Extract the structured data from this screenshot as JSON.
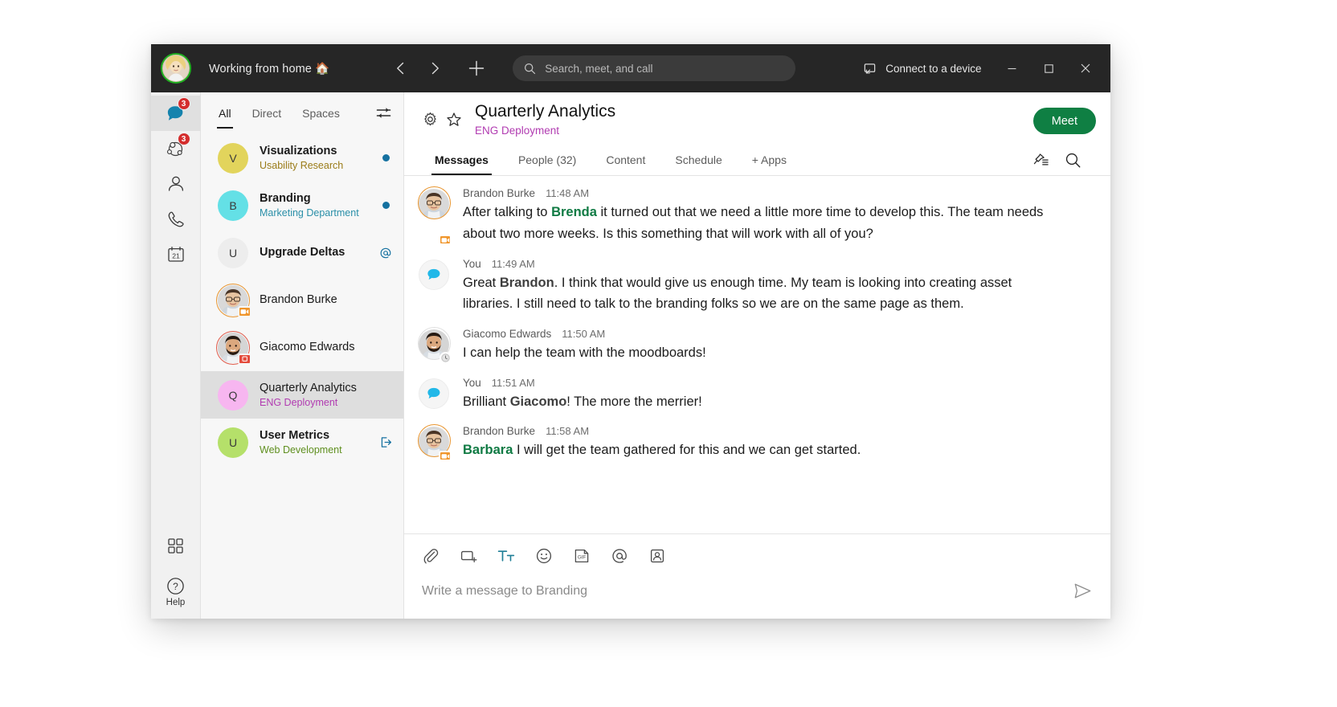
{
  "titlebar": {
    "status_text": "Working from home 🏠",
    "back_icon": "chevron-left-icon",
    "forward_icon": "chevron-right-icon",
    "add_icon": "plus-icon",
    "search_placeholder": "Search, meet, and call",
    "connect_label": "Connect to a device",
    "minimize_label": "–",
    "maximize_label": "□",
    "close_label": "✕"
  },
  "rail": {
    "items": [
      {
        "name": "messaging",
        "icon": "chat-bubble-icon",
        "badge": "3",
        "active": true
      },
      {
        "name": "teams",
        "icon": "teams-network-icon",
        "badge": "3",
        "active": false
      },
      {
        "name": "contacts",
        "icon": "person-icon",
        "badge": "",
        "active": false
      },
      {
        "name": "calling",
        "icon": "phone-icon",
        "badge": "",
        "active": false
      },
      {
        "name": "meetings",
        "icon": "calendar-21-icon",
        "badge": "",
        "active": false
      }
    ],
    "apps_icon": "apps-grid-icon",
    "help_icon": "question-circle-icon",
    "help_label": "Help"
  },
  "conversation_list": {
    "tabs": [
      {
        "label": "All",
        "active": true
      },
      {
        "label": "Direct",
        "active": false
      },
      {
        "label": "Spaces",
        "active": false
      }
    ],
    "filter_icon": "filter-sliders-icon",
    "items": [
      {
        "avatar_letter": "V",
        "avatar_color": "#e2d45c",
        "title": "Visualizations",
        "subtitle": "Usability Research",
        "subtitle_color": "#9a7b17",
        "bold": true,
        "indicator": "unread-dot",
        "selected": false,
        "avatar_type": "letter"
      },
      {
        "avatar_letter": "B",
        "avatar_color": "#64e0e6",
        "title": "Branding",
        "subtitle": "Marketing Department",
        "subtitle_color": "#2a8fa8",
        "bold": true,
        "indicator": "unread-dot",
        "selected": false,
        "avatar_type": "letter"
      },
      {
        "avatar_letter": "U",
        "avatar_color": "#ededed",
        "title": "Upgrade Deltas",
        "subtitle": "",
        "subtitle_color": "",
        "bold": true,
        "indicator": "mention-at",
        "selected": false,
        "avatar_type": "letter"
      },
      {
        "avatar_letter": "",
        "avatar_color": "#d5d5d5",
        "title": "Brandon Burke",
        "subtitle": "",
        "subtitle_color": "",
        "bold": false,
        "indicator": "",
        "selected": false,
        "avatar_type": "photo-man-glasses",
        "presence": "video"
      },
      {
        "avatar_letter": "",
        "avatar_color": "#d5d5d5",
        "title": "Giacomo Edwards",
        "subtitle": "",
        "subtitle_color": "",
        "bold": false,
        "indicator": "",
        "selected": false,
        "avatar_type": "photo-man-beard",
        "presence": "dnd"
      },
      {
        "avatar_letter": "Q",
        "avatar_color": "#f7b6f0",
        "title": "Quarterly Analytics",
        "subtitle": "ENG Deployment",
        "subtitle_color": "#b13bb1",
        "bold": false,
        "indicator": "",
        "selected": true,
        "avatar_type": "letter"
      },
      {
        "avatar_letter": "U",
        "avatar_color": "#b5e06a",
        "title": "User Metrics",
        "subtitle": "Web Development",
        "subtitle_color": "#5f8f1f",
        "bold": true,
        "indicator": "leave-space",
        "selected": false,
        "avatar_type": "letter"
      }
    ]
  },
  "space_header": {
    "settings_icon": "gear-icon",
    "favorite_icon": "star-icon",
    "title": "Quarterly Analytics",
    "subtitle": "ENG Deployment",
    "meet_button_label": "Meet",
    "meet_button_color": "#0f7f43",
    "tabs": [
      {
        "label": "Messages",
        "active": true
      },
      {
        "label": "People (32)",
        "active": false
      },
      {
        "label": "Content",
        "active": false
      },
      {
        "label": "Schedule",
        "active": false
      },
      {
        "label": "+ Apps",
        "active": false
      }
    ],
    "pin_icon": "pinned-list-icon",
    "search_icon": "search-icon"
  },
  "messages": [
    {
      "author": "Brandon Burke",
      "time": "11:48 AM",
      "avatar_type": "photo-man-glasses",
      "presence": "video",
      "segments": [
        {
          "t": "After talking to ",
          "style": "plain"
        },
        {
          "t": "Brenda",
          "style": "mention-green"
        },
        {
          "t": " it turned out that we need a little more time to develop this. The team needs about two more weeks. Is this something that will work with all of you?",
          "style": "plain"
        }
      ]
    },
    {
      "author": "You",
      "time": "11:49 AM",
      "avatar_type": "you-bubble",
      "presence": "",
      "segments": [
        {
          "t": "Great ",
          "style": "plain"
        },
        {
          "t": "Brandon",
          "style": "mention-dark"
        },
        {
          "t": ". I think that would give us enough time. My team is looking into creating asset libraries. I still need to talk to the branding folks so we are on the same page as them.",
          "style": "plain"
        }
      ]
    },
    {
      "author": "Giacomo Edwards",
      "time": "11:50 AM",
      "avatar_type": "photo-man-beard",
      "presence": "away",
      "segments": [
        {
          "t": "I can help the team with the moodboards!",
          "style": "plain"
        }
      ]
    },
    {
      "author": "You",
      "time": "11:51 AM",
      "avatar_type": "you-bubble",
      "presence": "",
      "segments": [
        {
          "t": "Brilliant ",
          "style": "plain"
        },
        {
          "t": "Giacomo",
          "style": "mention-dark"
        },
        {
          "t": "! The more the merrier!",
          "style": "plain"
        }
      ]
    },
    {
      "author": "Brandon Burke",
      "time": "11:58 AM",
      "avatar_type": "photo-man-glasses",
      "presence": "video",
      "segments": [
        {
          "t": "Barbara",
          "style": "mention-green"
        },
        {
          "t": " I will get the team gathered for this and we can get started.",
          "style": "plain"
        }
      ]
    }
  ],
  "composer": {
    "tools": [
      {
        "name": "attach-file-icon",
        "label": "attachment"
      },
      {
        "name": "screen-capture-icon",
        "label": "capture"
      },
      {
        "name": "format-text-icon",
        "label": "Tt",
        "active": true
      },
      {
        "name": "emoji-icon",
        "label": "emoji"
      },
      {
        "name": "gif-icon",
        "label": "GIF"
      },
      {
        "name": "mention-icon",
        "label": "@"
      },
      {
        "name": "person-card-icon",
        "label": "person"
      }
    ],
    "placeholder": "Write a message to Branding",
    "send_icon": "send-icon"
  }
}
